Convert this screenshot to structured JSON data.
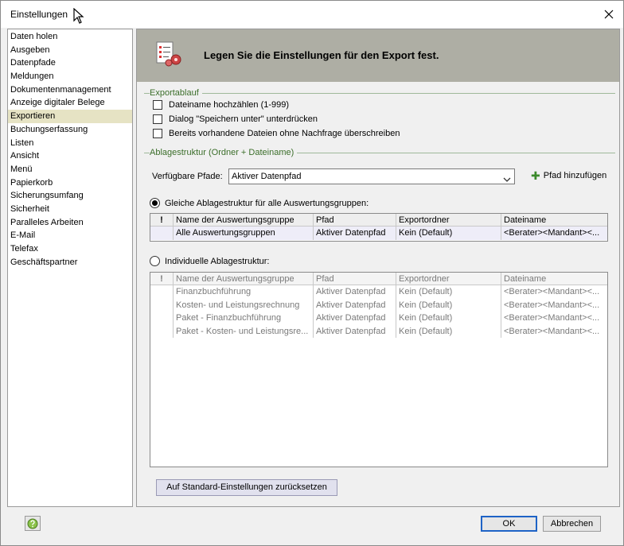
{
  "window": {
    "title": "Einstellungen"
  },
  "nav": {
    "items": [
      "Daten holen",
      "Ausgeben",
      "Datenpfade",
      "Meldungen",
      "Dokumentenmanagement",
      "Anzeige digitaler Belege",
      "Exportieren",
      "Buchungserfassung",
      "Listen",
      "Ansicht",
      "Menü",
      "Papierkorb",
      "Sicherungsumfang",
      "Sicherheit",
      "Paralleles Arbeiten",
      "E-Mail",
      "Telefax",
      "Geschäftspartner"
    ],
    "active": "Exportieren"
  },
  "banner": {
    "title": "Legen Sie die Einstellungen für den Export fest."
  },
  "exportablauf": {
    "title": "Exportablauf",
    "options": [
      {
        "label": "Dateiname hochzählen (1-999)",
        "checked": false
      },
      {
        "label": "Dialog \"Speichern unter\" unterdrücken",
        "checked": false
      },
      {
        "label": "Bereits vorhandene Dateien ohne Nachfrage überschreiben",
        "checked": false
      }
    ]
  },
  "ablage": {
    "title": "Ablagestruktur (Ordner + Dateiname)",
    "paths_label": "Verfügbare Pfade:",
    "paths_value": "Aktiver Datenpfad",
    "add_path": "Pfad hinzufügen",
    "same_label": "Gleiche Ablagestruktur für alle Auswertungsgruppen:",
    "individual_label": "Individuelle Ablagestruktur:",
    "columns": [
      "!",
      "Name der Auswertungsgruppe",
      "Pfad",
      "Exportordner",
      "Dateiname"
    ],
    "same_rows": [
      [
        "",
        "Alle Auswertungsgruppen",
        "Aktiver Datenpfad",
        "Kein (Default)",
        "<Berater><Mandant><..."
      ]
    ],
    "individual_rows": [
      [
        "",
        "Finanzbuchführung",
        "Aktiver Datenpfad",
        "Kein (Default)",
        "<Berater><Mandant><..."
      ],
      [
        "",
        "Kosten- und Leistungsrechnung",
        "Aktiver Datenpfad",
        "Kein (Default)",
        "<Berater><Mandant><..."
      ],
      [
        "",
        "Paket - Finanzbuchführung",
        "Aktiver Datenpfad",
        "Kein (Default)",
        "<Berater><Mandant><..."
      ],
      [
        "",
        "Paket - Kosten- und Leistungsre...",
        "Aktiver Datenpfad",
        "Kein (Default)",
        "<Berater><Mandant><..."
      ]
    ]
  },
  "buttons": {
    "reset": "Auf Standard-Einstellungen zurücksetzen",
    "ok": "OK",
    "cancel": "Abbrechen"
  },
  "colors": {
    "group_title": "#3b6e2a",
    "nav_active": "#e6e3c4",
    "banner": "#aeaea4",
    "ok_border": "#1e63c6"
  }
}
